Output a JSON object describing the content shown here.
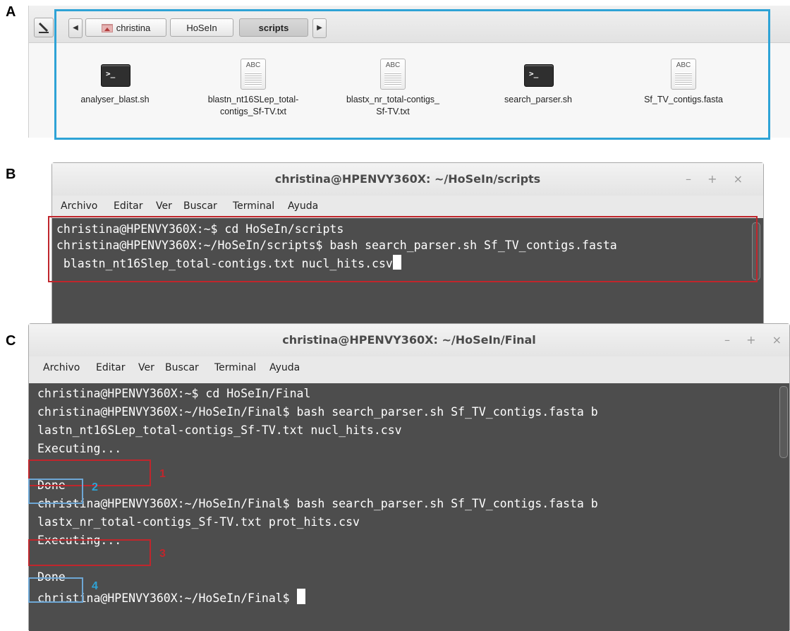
{
  "panel_labels": {
    "a": "A",
    "b": "B",
    "c": "C"
  },
  "file_manager": {
    "breadcrumbs": [
      "christina",
      "HoSeIn",
      "scripts"
    ],
    "active_crumb": "scripts",
    "files": [
      {
        "name_lines": [
          "analyser_blast.sh"
        ],
        "type": "script"
      },
      {
        "name_lines": [
          "blastn_nt16SLep_total-",
          "contigs_Sf-TV.txt"
        ],
        "type": "text"
      },
      {
        "name_lines": [
          "blastx_nr_total-contigs_",
          "Sf-TV.txt"
        ],
        "type": "text"
      },
      {
        "name_lines": [
          "search_parser.sh"
        ],
        "type": "script"
      },
      {
        "name_lines": [
          "Sf_TV_contigs.fasta"
        ],
        "type": "text"
      }
    ],
    "script_icon_text": ">_",
    "text_icon_text": "ABC"
  },
  "terminal_b": {
    "title": "christina@HPENVY360X: ~/HoSeIn/scripts",
    "controls": [
      "–",
      "+",
      "×"
    ],
    "menu": [
      "Archivo",
      "Editar",
      "Ver",
      "Buscar",
      "Terminal",
      "Ayuda"
    ],
    "lines": [
      "christina@HPENVY360X:~$ cd HoSeIn/scripts",
      "christina@HPENVY360X:~/HoSeIn/scripts$ bash search_parser.sh Sf_TV_contigs.fasta",
      " blastn_nt16Slep_total-contigs.txt nucl_hits.csv"
    ]
  },
  "terminal_c": {
    "title": "christina@HPENVY360X: ~/HoSeIn/Final",
    "controls": [
      "–",
      "+",
      "×"
    ],
    "menu": [
      "Archivo",
      "Editar",
      "Ver",
      "Buscar",
      "Terminal",
      "Ayuda"
    ],
    "lines": [
      "christina@HPENVY360X:~$ cd HoSeIn/Final",
      "christina@HPENVY360X:~/HoSeIn/Final$ bash search_parser.sh Sf_TV_contigs.fasta b",
      "lastn_nt16SLep_total-contigs_Sf-TV.txt nucl_hits.csv",
      "Executing...",
      "",
      "Done",
      "christina@HPENVY360X:~/HoSeIn/Final$ bash search_parser.sh Sf_TV_contigs.fasta b",
      "lastx_nr_total-contigs_Sf-TV.txt prot_hits.csv",
      "Executing...",
      "",
      "Done",
      "christina@HPENVY360X:~/HoSeIn/Final$ "
    ]
  },
  "annotations": {
    "n1": "1",
    "n2": "2",
    "n3": "3",
    "n4": "4"
  },
  "colors": {
    "red_box": "#c0262c",
    "blue_box": "#2ea3d6",
    "light_blue_box": "#6ea7d5",
    "terminal_bg": "#4d4d4d",
    "num_red": "#c0262c",
    "num_blue": "#2ea3d6"
  }
}
